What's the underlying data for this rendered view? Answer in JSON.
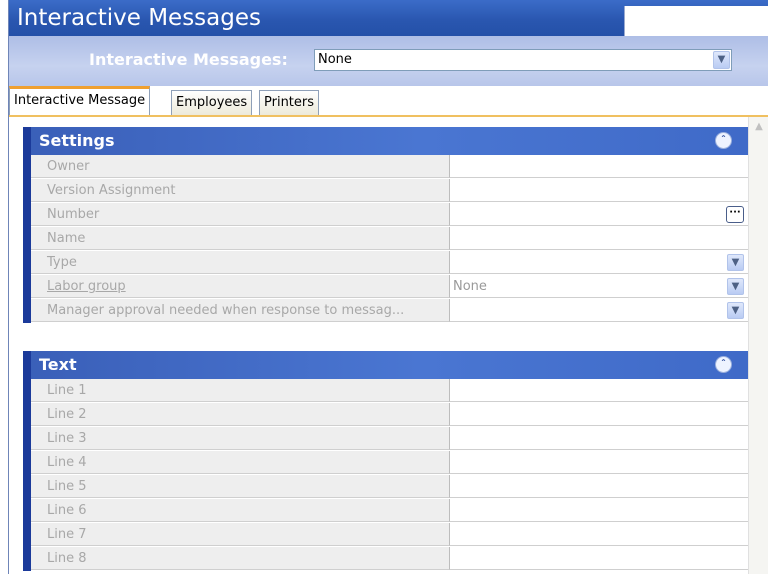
{
  "title": "Interactive Messages",
  "filter": {
    "label": "Interactive Messages:",
    "value": "None"
  },
  "tabs": [
    {
      "label": "Interactive Message",
      "active": true
    },
    {
      "label": "Employees",
      "active": false
    },
    {
      "label": "Printers",
      "active": false
    }
  ],
  "sections": {
    "settings": {
      "title": "Settings",
      "rows": [
        {
          "label": "Owner",
          "value": ""
        },
        {
          "label": "Version Assignment",
          "value": ""
        },
        {
          "label": "Number",
          "value": ""
        },
        {
          "label": "Name",
          "value": ""
        },
        {
          "label": "Type",
          "value": ""
        },
        {
          "label": "Labor group",
          "value": "None"
        },
        {
          "label": "Manager approval needed when response to messag...",
          "value": ""
        }
      ]
    },
    "text": {
      "title": "Text",
      "rows": [
        {
          "label": "Line 1",
          "value": ""
        },
        {
          "label": "Line 2",
          "value": ""
        },
        {
          "label": "Line 3",
          "value": ""
        },
        {
          "label": "Line 4",
          "value": ""
        },
        {
          "label": "Line 5",
          "value": ""
        },
        {
          "label": "Line 6",
          "value": ""
        },
        {
          "label": "Line 7",
          "value": ""
        },
        {
          "label": "Line 8",
          "value": ""
        }
      ]
    }
  },
  "icons": {
    "dropdown": "chevron-down-icon",
    "collapse": "double-chevron-up-icon",
    "ellipsis": "ellipsis-icon"
  }
}
